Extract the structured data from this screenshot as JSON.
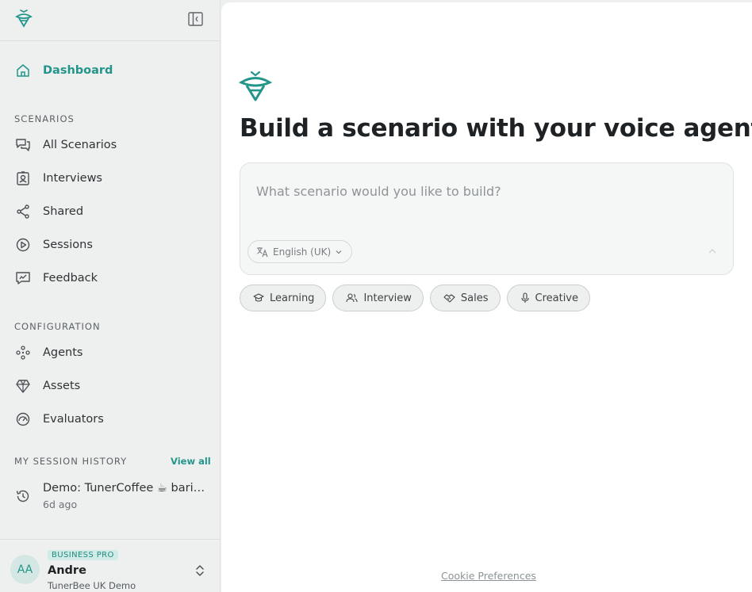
{
  "sidebar": {
    "nav_main": {
      "label": "Dashboard"
    },
    "scenarios_heading": "SCENARIOS",
    "scenarios": [
      {
        "label": "All Scenarios",
        "icon": "chat-bubbles-icon"
      },
      {
        "label": "Interviews",
        "icon": "id-badge-icon"
      },
      {
        "label": "Shared",
        "icon": "share-icon"
      },
      {
        "label": "Sessions",
        "icon": "play-circle-icon"
      },
      {
        "label": "Feedback",
        "icon": "feedback-icon"
      }
    ],
    "configuration_heading": "CONFIGURATION",
    "configuration": [
      {
        "label": "Agents",
        "icon": "agents-icon"
      },
      {
        "label": "Assets",
        "icon": "gem-icon"
      },
      {
        "label": "Evaluators",
        "icon": "gauge-icon"
      }
    ],
    "history_heading": "MY SESSION HISTORY",
    "view_all_label": "View all",
    "history": [
      {
        "title": "Demo: TunerCoffee ☕ barista training",
        "time": "6d ago"
      }
    ],
    "user": {
      "initials": "AA",
      "plan": "BUSINESS PRO",
      "name": "Andre",
      "org": "TunerBee UK Demo"
    }
  },
  "main": {
    "headline": "Build a scenario with your voice agents",
    "prompt_placeholder": "What scenario would you like to build?",
    "language": "English (UK)",
    "chips": [
      "Learning",
      "Interview",
      "Sales",
      "Creative"
    ],
    "cookie_link": "Cookie Preferences"
  },
  "colors": {
    "accent": "#23958a",
    "sidebar_bg": "#eef0f0",
    "main_bg": "#ffffff"
  }
}
